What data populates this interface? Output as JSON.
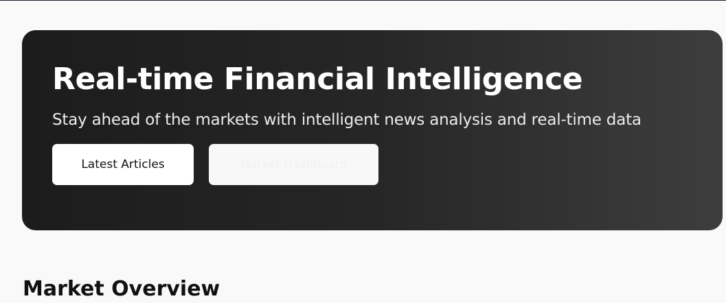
{
  "hero": {
    "title": "Real-time Financial Intelligence",
    "subtitle": "Stay ahead of the markets with intelligent news analysis and real-time data",
    "buttons": {
      "primary": "Latest Articles",
      "secondary": "Market Dashboard"
    }
  },
  "sections": {
    "market_overview_title": "Market Overview"
  },
  "colors": {
    "page_background": "#f9f9f9",
    "hero_gradient_start": "#1c1c1c",
    "hero_gradient_end": "#3d3d3d",
    "primary_button_background": "#ffffff",
    "primary_button_text": "#111111"
  }
}
